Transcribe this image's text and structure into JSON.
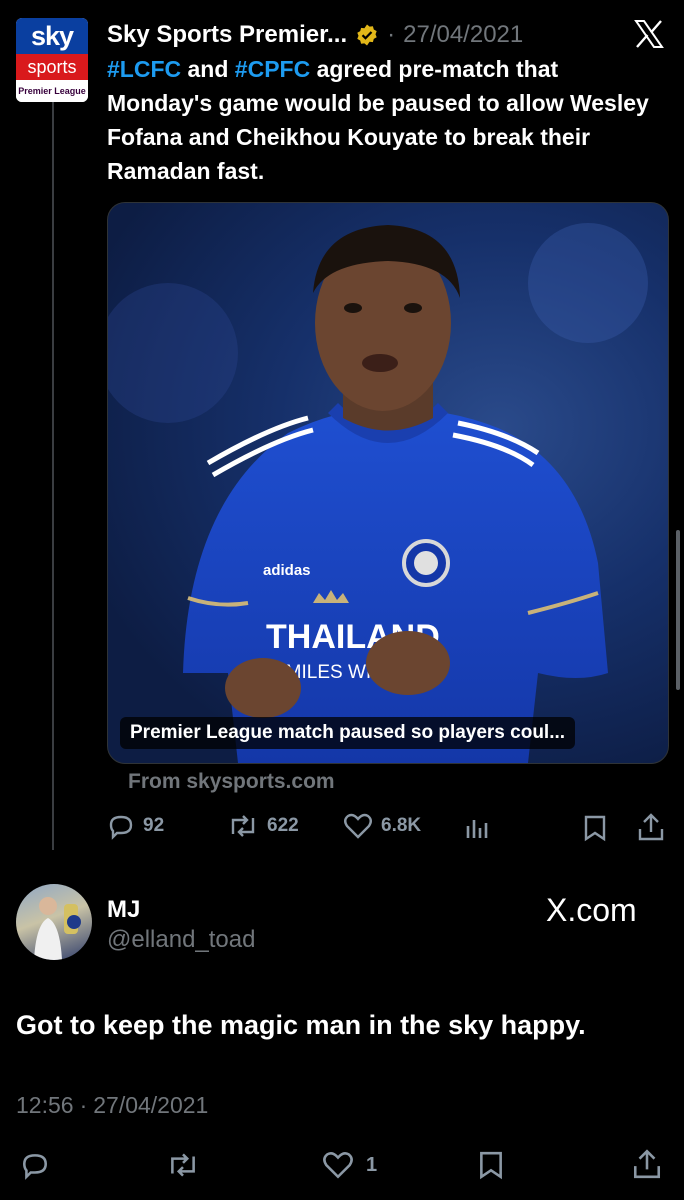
{
  "quoted_tweet": {
    "avatar": {
      "line1": "sky",
      "line2": "sports",
      "line3": "Premier League"
    },
    "author_name": "Sky Sports Premier...",
    "separator": "·",
    "date": "27/04/2021",
    "text": {
      "hashtag1": "#LCFC",
      "word_and": " and ",
      "hashtag2": "#CPFC",
      "rest": " agreed pre-match that Monday's game would be paused to allow Wesley Fofana and Cheikhou Kouyate to break their Ramadan fast."
    },
    "card": {
      "shirt_text_1": "THAILAND",
      "shirt_text_2": "SMILES WITH YOU",
      "caption": "Premier League match paused so players coul...",
      "source": "From skysports.com"
    },
    "actions": {
      "replies": "92",
      "reposts": "622",
      "likes": "6.8K"
    }
  },
  "reply_tweet": {
    "display_name": "MJ",
    "handle": "@elland_toad",
    "watermark": "X.com",
    "text": "Got to keep the magic man in the sky happy.",
    "time": "12:56",
    "separator": "·",
    "date": "27/04/2021",
    "actions": {
      "likes": "1"
    }
  },
  "colors": {
    "accent": "#1d9bf0",
    "verified": "#e2b719",
    "muted": "#71767b",
    "background": "#000000"
  }
}
